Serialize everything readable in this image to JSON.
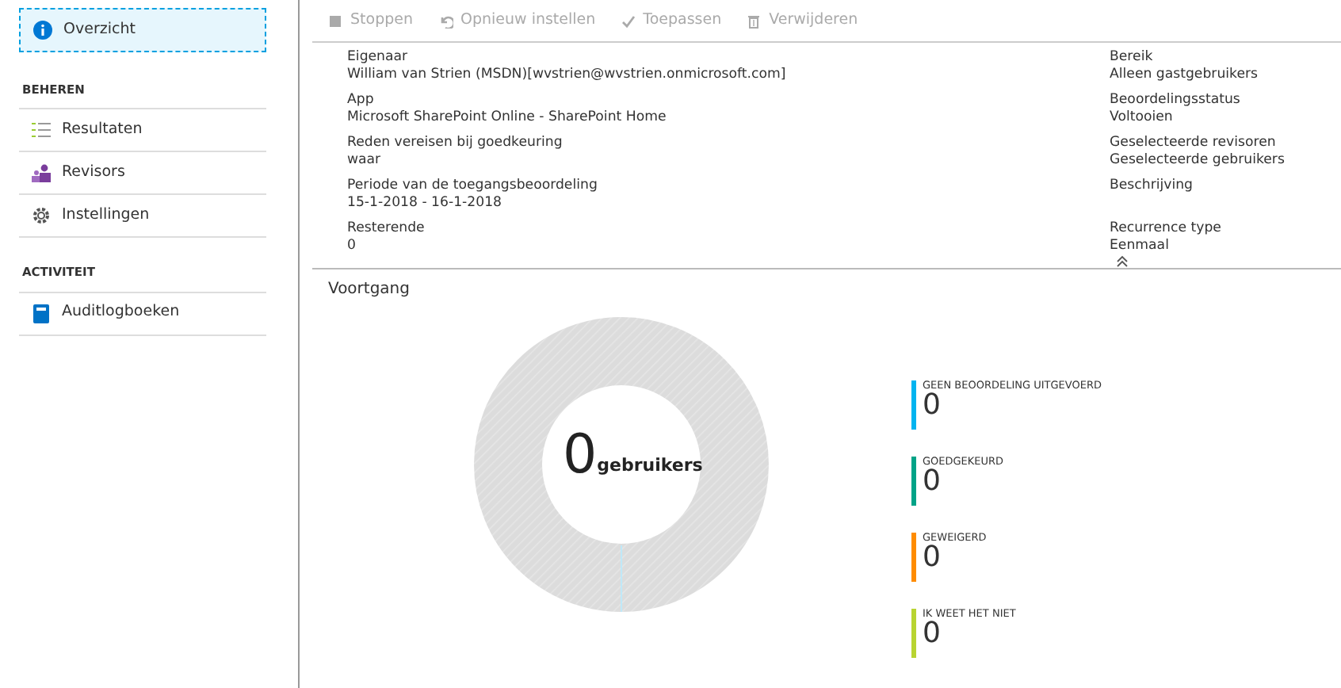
{
  "sidebar": {
    "items": [
      {
        "label": "Overzicht",
        "selected": true
      }
    ],
    "sections": [
      {
        "title": "BEHEREN",
        "items": [
          {
            "label": "Resultaten",
            "selected": false
          },
          {
            "label": "Revisors",
            "selected": false
          },
          {
            "label": "Instellingen",
            "selected": false
          }
        ]
      },
      {
        "title": "ACTIVITEIT",
        "items": [
          {
            "label": "Auditlogboeken",
            "selected": false
          }
        ]
      }
    ]
  },
  "toolbar": [
    {
      "label": "Stoppen",
      "disabled": true
    },
    {
      "label": "Opnieuw instellen",
      "disabled": true
    },
    {
      "label": "Toepassen",
      "disabled": true
    },
    {
      "label": "Verwijderen",
      "disabled": true
    }
  ],
  "details_left": [
    {
      "label": "Eigenaar",
      "value": "William van Strien (MSDN)[wvstrien@wvstrien.onmicrosoft.com]"
    },
    {
      "label": "App",
      "value": "Microsoft SharePoint Online - SharePoint Home"
    },
    {
      "label": "Reden vereisen bij goedkeuring",
      "value": "waar"
    },
    {
      "label": "Periode van de toegangsbeoordeling",
      "value": "15-1-2018 - 16-1-2018"
    },
    {
      "label": "Resterende",
      "value": "0"
    }
  ],
  "details_right": [
    {
      "label": "Bereik",
      "value": "Alleen gastgebruikers"
    },
    {
      "label": "Beoordelingsstatus",
      "value": "Voltooien"
    },
    {
      "label": "Geselecteerde revisoren",
      "value": "Geselecteerde gebruikers"
    },
    {
      "label": "Beschrijving"
    },
    {
      "label": "Recurrence type",
      "value": "Eenmaal"
    }
  ],
  "progress": {
    "title": "Voortgang",
    "total": "0",
    "unit": "gebruikers",
    "legend": [
      {
        "label": "GEEN BEOORDELING UITGEVOERD",
        "value": "0",
        "color": "#00b4f0"
      },
      {
        "label": "GOEDGEKEURD",
        "value": "0",
        "color": "#00a387"
      },
      {
        "label": "GEWEIGERD",
        "value": "0",
        "color": "#ff8c00"
      },
      {
        "label": "IK WEET HET NIET",
        "value": "0",
        "color": "#b8d432"
      }
    ]
  }
}
